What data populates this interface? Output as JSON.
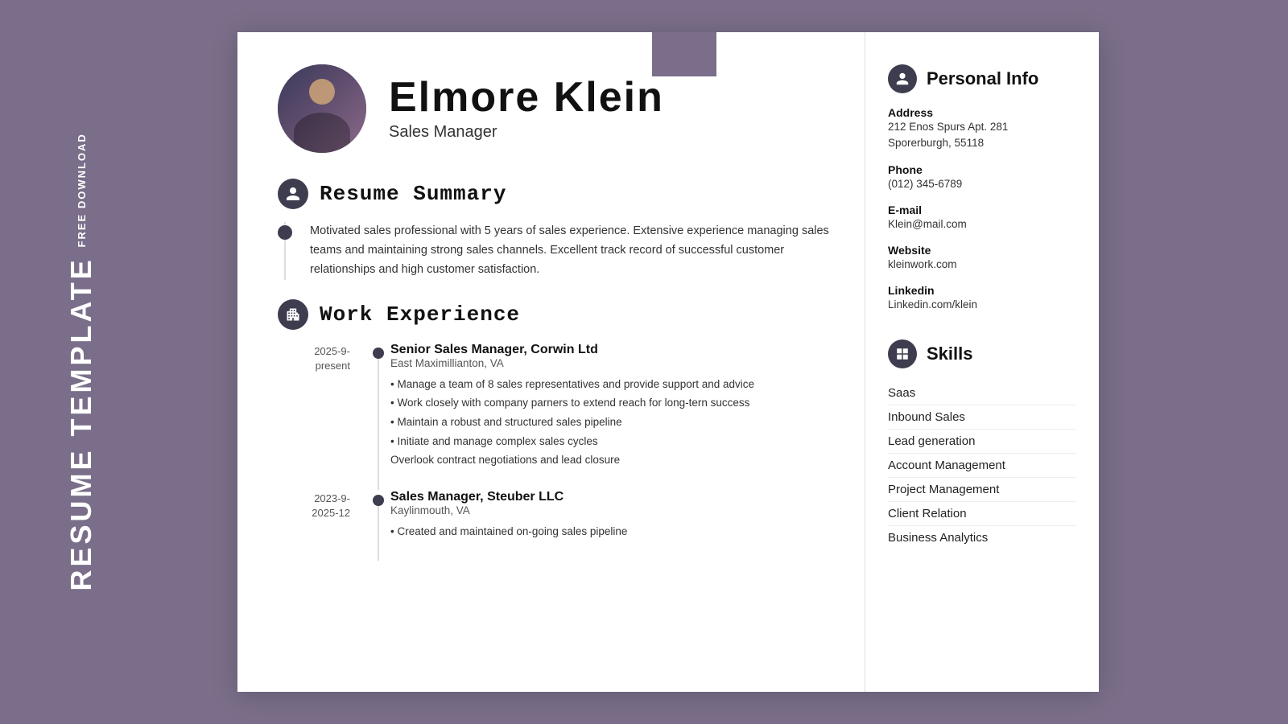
{
  "sidebar": {
    "free_download": "FREE DOWNLOAD",
    "title": "RESUME TEMPLATE"
  },
  "header": {
    "name": "Elmore Klein",
    "title": "Sales Manager"
  },
  "summary": {
    "section_title": "Resume Summary",
    "text": "Motivated sales professional with 5 years of sales experience. Extensive experience managing sales teams and maintaining strong sales channels. Excellent track record of successful customer relationships and high customer satisfaction."
  },
  "work_experience": {
    "section_title": "Work Experience",
    "jobs": [
      {
        "title": "Senior Sales Manager, Corwin Ltd",
        "location": "East Maximillianton, VA",
        "date_start": "2025-9-",
        "date_end": "present",
        "bullets": [
          "• Manage a team of 8 sales representatives and provide support and advice",
          "• Work closely with company parners to extend reach for long-tern success",
          "• Maintain a robust and structured sales pipeline",
          "• Initiate and manage complex sales cycles",
          "Overlook contract negotiations and lead closure"
        ]
      },
      {
        "title": "Sales Manager, Steuber LLC",
        "location": "Kaylinmouth, VA",
        "date_start": "2023-9-",
        "date_end": "2025-12",
        "bullets": [
          "• Created and maintained on-going sales pipeline"
        ]
      }
    ]
  },
  "personal_info": {
    "section_title": "Personal Info",
    "fields": [
      {
        "label": "Address",
        "value": "212 Enos Spurs Apt. 281\nSporerburgh, 55118"
      },
      {
        "label": "Phone",
        "value": "(012) 345-6789"
      },
      {
        "label": "E-mail",
        "value": "Klein@mail.com"
      },
      {
        "label": "Website",
        "value": "kleinwork.com"
      },
      {
        "label": "Linkedin",
        "value": "Linkedin.com/klein"
      }
    ]
  },
  "skills": {
    "section_title": "Skills",
    "items": [
      "Saas",
      "Inbound Sales",
      "Lead generation",
      "Account Management",
      "Project Management",
      "Client Relation",
      "Business Analytics"
    ]
  }
}
